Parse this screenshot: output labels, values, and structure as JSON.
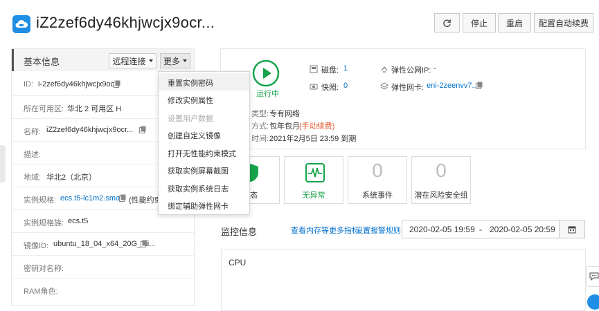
{
  "header": {
    "instance_name": "iZ2zef6dy46khjwcjx9ocr...",
    "buttons": {
      "refresh_icon": "refresh-icon",
      "stop": "停止",
      "restart": "重启",
      "auto_renew": "配置自动续费"
    }
  },
  "basic_info": {
    "title": "基本信息",
    "remote_connect": "远程连接",
    "more": "更多",
    "rows": [
      {
        "label": "ID:",
        "value": "i-2zef6dy46khjwcjx9ocr"
      },
      {
        "label": "所在可用区:",
        "value": "华北 2 可用区 H"
      },
      {
        "label": "名称:",
        "value": "iZ2zef6dy46khjwcjx9ocr..."
      },
      {
        "label": "描述:",
        "value": ""
      },
      {
        "label": "地域:",
        "value": "华北2（北京）"
      },
      {
        "label": "实例规格:",
        "value": "ecs.t5-lc1m2.small",
        "extra": "(性能约束"
      },
      {
        "label": "实例规格族:",
        "value": "ecs.t5"
      },
      {
        "label": "镜像ID:",
        "value": "ubuntu_18_04_x64_20G_ali..."
      },
      {
        "label": "密钥对名称:",
        "value": ""
      },
      {
        "label": "RAM角色:",
        "value": ""
      }
    ]
  },
  "more_menu": {
    "items": [
      {
        "label": "重置实例密码",
        "state": "hover"
      },
      {
        "label": "修改实例属性",
        "state": "normal"
      },
      {
        "label": "设置用户数据",
        "state": "disabled"
      },
      {
        "label": "创建自定义镜像",
        "state": "normal"
      },
      {
        "label": "打开无性能约束模式",
        "state": "normal"
      },
      {
        "label": "获取实例屏幕截图",
        "state": "normal"
      },
      {
        "label": "获取实例系统日志",
        "state": "normal"
      },
      {
        "label": "绑定辅助弹性网卡",
        "state": "normal"
      }
    ]
  },
  "status": {
    "running_label": "运行中",
    "disk_label": "磁盘:",
    "disk_value": "1",
    "snapshot_label": "快照:",
    "snapshot_value": "0",
    "eip_label": "弹性公网IP:",
    "eip_value": "-",
    "eni_label": "弹性网卡:",
    "eni_value": "eni-2zeenvv7...",
    "network_type_label": "类型:",
    "network_type_value": "专有网络",
    "billing_label": "方式:",
    "billing_value": "包年包月",
    "billing_extra": "(手动续费)",
    "expire_label": "时间:",
    "expire_value": "2021年2月5日 23:59 到期",
    "accent_green": "#16a34a"
  },
  "tiles": [
    {
      "label": "状态",
      "value": ""
    },
    {
      "label": "无异常",
      "value": ""
    },
    {
      "label": "系统事件",
      "value": "0"
    },
    {
      "label": "潜在风险安全组",
      "value": "0"
    }
  ],
  "monitor": {
    "title": "监控信息",
    "link_more": "查看内存等更多指标",
    "link_alarm": "设置报警规则",
    "date_start": "2020-02-05 19:59",
    "date_sep": "-",
    "date_end": "2020-02-05 20:59",
    "cpu_label": "CPU"
  }
}
